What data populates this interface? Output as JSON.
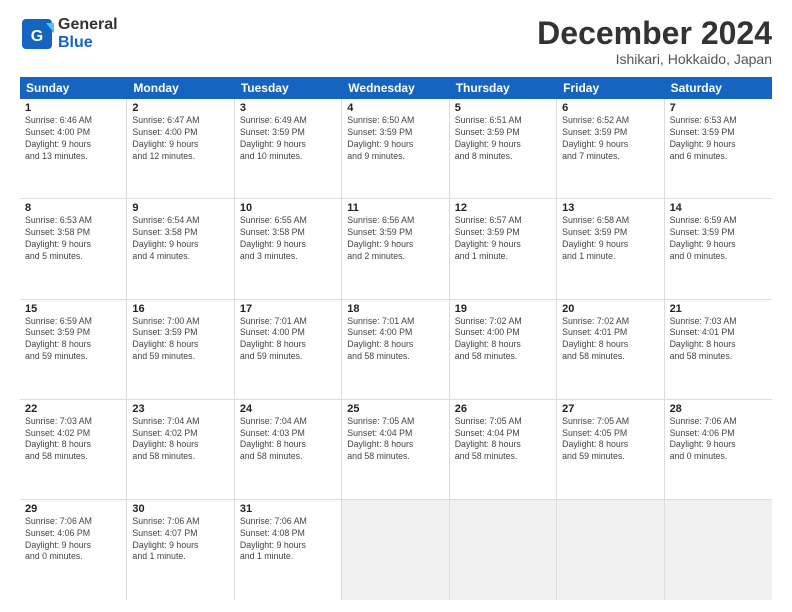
{
  "logo": {
    "line1": "General",
    "line2": "Blue"
  },
  "title": "December 2024",
  "subtitle": "Ishikari, Hokkaido, Japan",
  "header_days": [
    "Sunday",
    "Monday",
    "Tuesday",
    "Wednesday",
    "Thursday",
    "Friday",
    "Saturday"
  ],
  "weeks": [
    [
      {
        "day": "1",
        "info": "Sunrise: 6:46 AM\nSunset: 4:00 PM\nDaylight: 9 hours\nand 13 minutes."
      },
      {
        "day": "2",
        "info": "Sunrise: 6:47 AM\nSunset: 4:00 PM\nDaylight: 9 hours\nand 12 minutes."
      },
      {
        "day": "3",
        "info": "Sunrise: 6:49 AM\nSunset: 3:59 PM\nDaylight: 9 hours\nand 10 minutes."
      },
      {
        "day": "4",
        "info": "Sunrise: 6:50 AM\nSunset: 3:59 PM\nDaylight: 9 hours\nand 9 minutes."
      },
      {
        "day": "5",
        "info": "Sunrise: 6:51 AM\nSunset: 3:59 PM\nDaylight: 9 hours\nand 8 minutes."
      },
      {
        "day": "6",
        "info": "Sunrise: 6:52 AM\nSunset: 3:59 PM\nDaylight: 9 hours\nand 7 minutes."
      },
      {
        "day": "7",
        "info": "Sunrise: 6:53 AM\nSunset: 3:59 PM\nDaylight: 9 hours\nand 6 minutes."
      }
    ],
    [
      {
        "day": "8",
        "info": "Sunrise: 6:53 AM\nSunset: 3:58 PM\nDaylight: 9 hours\nand 5 minutes."
      },
      {
        "day": "9",
        "info": "Sunrise: 6:54 AM\nSunset: 3:58 PM\nDaylight: 9 hours\nand 4 minutes."
      },
      {
        "day": "10",
        "info": "Sunrise: 6:55 AM\nSunset: 3:58 PM\nDaylight: 9 hours\nand 3 minutes."
      },
      {
        "day": "11",
        "info": "Sunrise: 6:56 AM\nSunset: 3:59 PM\nDaylight: 9 hours\nand 2 minutes."
      },
      {
        "day": "12",
        "info": "Sunrise: 6:57 AM\nSunset: 3:59 PM\nDaylight: 9 hours\nand 1 minute."
      },
      {
        "day": "13",
        "info": "Sunrise: 6:58 AM\nSunset: 3:59 PM\nDaylight: 9 hours\nand 1 minute."
      },
      {
        "day": "14",
        "info": "Sunrise: 6:59 AM\nSunset: 3:59 PM\nDaylight: 9 hours\nand 0 minutes."
      }
    ],
    [
      {
        "day": "15",
        "info": "Sunrise: 6:59 AM\nSunset: 3:59 PM\nDaylight: 8 hours\nand 59 minutes."
      },
      {
        "day": "16",
        "info": "Sunrise: 7:00 AM\nSunset: 3:59 PM\nDaylight: 8 hours\nand 59 minutes."
      },
      {
        "day": "17",
        "info": "Sunrise: 7:01 AM\nSunset: 4:00 PM\nDaylight: 8 hours\nand 59 minutes."
      },
      {
        "day": "18",
        "info": "Sunrise: 7:01 AM\nSunset: 4:00 PM\nDaylight: 8 hours\nand 58 minutes."
      },
      {
        "day": "19",
        "info": "Sunrise: 7:02 AM\nSunset: 4:00 PM\nDaylight: 8 hours\nand 58 minutes."
      },
      {
        "day": "20",
        "info": "Sunrise: 7:02 AM\nSunset: 4:01 PM\nDaylight: 8 hours\nand 58 minutes."
      },
      {
        "day": "21",
        "info": "Sunrise: 7:03 AM\nSunset: 4:01 PM\nDaylight: 8 hours\nand 58 minutes."
      }
    ],
    [
      {
        "day": "22",
        "info": "Sunrise: 7:03 AM\nSunset: 4:02 PM\nDaylight: 8 hours\nand 58 minutes."
      },
      {
        "day": "23",
        "info": "Sunrise: 7:04 AM\nSunset: 4:02 PM\nDaylight: 8 hours\nand 58 minutes."
      },
      {
        "day": "24",
        "info": "Sunrise: 7:04 AM\nSunset: 4:03 PM\nDaylight: 8 hours\nand 58 minutes."
      },
      {
        "day": "25",
        "info": "Sunrise: 7:05 AM\nSunset: 4:04 PM\nDaylight: 8 hours\nand 58 minutes."
      },
      {
        "day": "26",
        "info": "Sunrise: 7:05 AM\nSunset: 4:04 PM\nDaylight: 8 hours\nand 58 minutes."
      },
      {
        "day": "27",
        "info": "Sunrise: 7:05 AM\nSunset: 4:05 PM\nDaylight: 8 hours\nand 59 minutes."
      },
      {
        "day": "28",
        "info": "Sunrise: 7:06 AM\nSunset: 4:06 PM\nDaylight: 9 hours\nand 0 minutes."
      }
    ],
    [
      {
        "day": "29",
        "info": "Sunrise: 7:06 AM\nSunset: 4:06 PM\nDaylight: 9 hours\nand 0 minutes."
      },
      {
        "day": "30",
        "info": "Sunrise: 7:06 AM\nSunset: 4:07 PM\nDaylight: 9 hours\nand 1 minute."
      },
      {
        "day": "31",
        "info": "Sunrise: 7:06 AM\nSunset: 4:08 PM\nDaylight: 9 hours\nand 1 minute."
      },
      {
        "day": "",
        "info": ""
      },
      {
        "day": "",
        "info": ""
      },
      {
        "day": "",
        "info": ""
      },
      {
        "day": "",
        "info": ""
      }
    ]
  ]
}
